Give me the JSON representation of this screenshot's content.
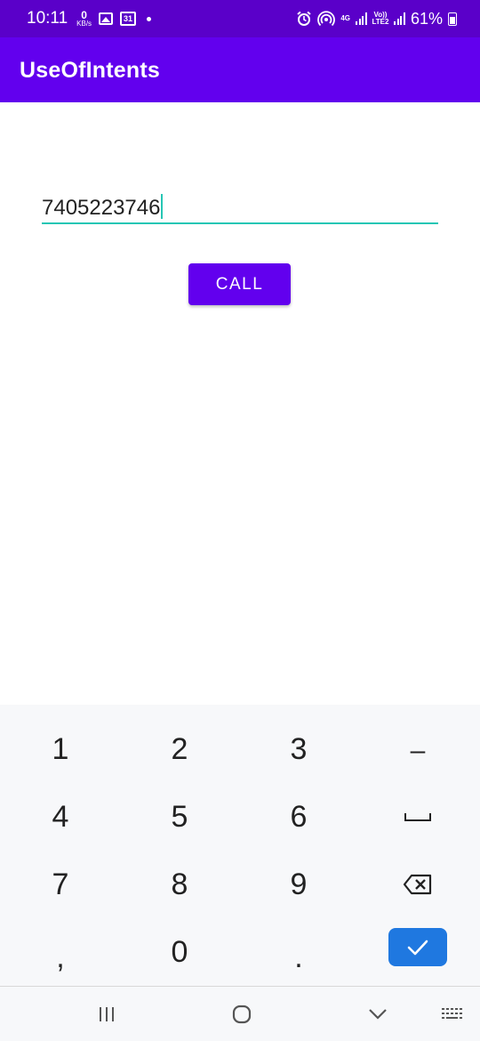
{
  "status_bar": {
    "time": "10:11",
    "net_speed_value": "0",
    "net_speed_unit": "KB/s",
    "calendar_day": "31",
    "network_type": "4G",
    "volte_label": "Vo))",
    "lte_label": "LTE2",
    "battery_percent": "61%"
  },
  "app_bar": {
    "title": "UseOfIntents",
    "color": "#6200ee"
  },
  "form": {
    "phone_number": "7405223746",
    "call_label": "CALL",
    "underline_color": "#26c6b4"
  },
  "keyboard": {
    "keys": [
      "1",
      "2",
      "3",
      "–",
      "4",
      "5",
      "6",
      "␣",
      "7",
      "8",
      "9",
      "⌫",
      ",",
      "0",
      "."
    ],
    "done_icon": "checkmark-icon",
    "done_color": "#1f78e0"
  },
  "nav_bar": {
    "icons": [
      "recents-icon",
      "home-icon",
      "back-icon",
      "keyboard-switch-icon"
    ]
  }
}
